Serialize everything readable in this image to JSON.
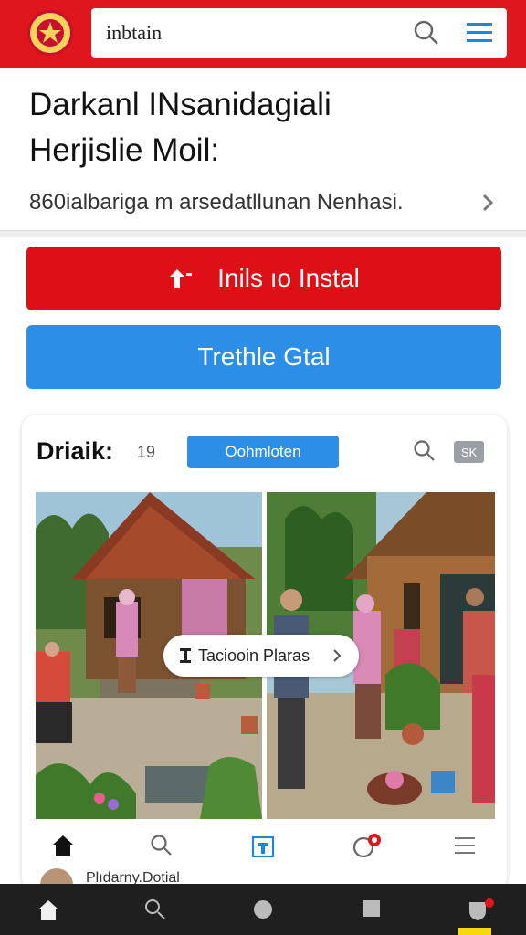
{
  "header": {
    "search_value": "inbtain",
    "logo_icon": "emblem-logo",
    "search_icon": "search-icon",
    "menu_icon": "hamburger-menu-icon"
  },
  "headline": {
    "title_line1": "Darkanl INsanidagiali",
    "title_line2": "Herjislie Moil:",
    "subtitle": "860ialbariga m arsedatllunan Nenhasi."
  },
  "actions": {
    "primary_label": "Inils ıo Instal",
    "secondary_label": "Trethle Gtal"
  },
  "card": {
    "title": "Driaik:",
    "count": "19",
    "chip_label": "Oohmloten",
    "share_label": "SK",
    "overlay_label": "Taciooin Plaras",
    "footer_name": "Plıdarny.Dotial"
  },
  "colors": {
    "brand_red": "#e0161e",
    "accent_blue": "#2d8ee8",
    "navbar": "#1f1f1f"
  }
}
